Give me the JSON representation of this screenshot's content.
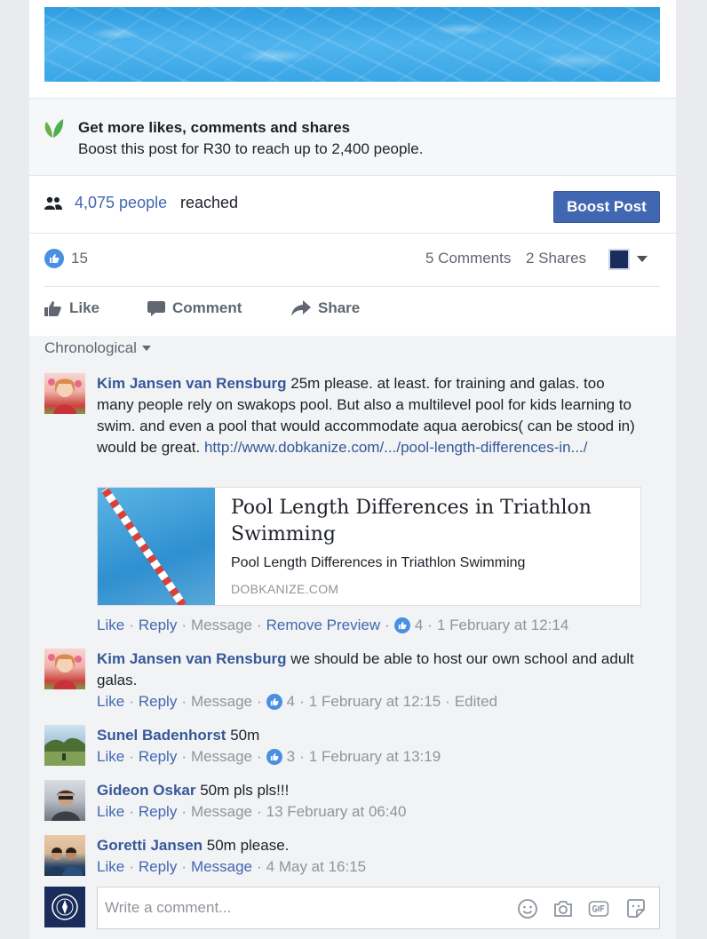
{
  "boost_cta": {
    "title": "Get more likes, comments and shares",
    "subtitle": "Boost this post for R30 to reach up to 2,400 people."
  },
  "reach": {
    "count": "4,075 people",
    "suffix": "reached",
    "boost_button": "Boost Post"
  },
  "stats": {
    "likes": "15",
    "comments": "5 Comments",
    "shares": "2 Shares"
  },
  "actions": {
    "like": "Like",
    "comment": "Comment",
    "share": "Share"
  },
  "comments_sort": "Chronological",
  "comments": [
    {
      "author": "Kim Jansen van Rensburg",
      "text": " 25m please. at least. for training and galas. too many people rely on swakops pool. But also a multilevel pool for kids learning to swim. and even a pool that would accommodate aqua aerobics( can be stood in) would be great. ",
      "link": "http://www.dobkanize.com/.../pool-length-differences-in.../",
      "preview": {
        "title": "Pool Length Differences in Triathlon Swimming",
        "subtitle": "Pool Length Differences in Triathlon Swimming",
        "domain": "DOBKANIZE.COM"
      },
      "meta": {
        "like": "Like",
        "reply": "Reply",
        "message": "Message",
        "remove_preview": "Remove Preview",
        "likes": "4",
        "time": "1 February at 12:14"
      }
    },
    {
      "author": "Kim Jansen van Rensburg",
      "text": " we should be able to host our own school and adult galas.",
      "meta": {
        "like": "Like",
        "reply": "Reply",
        "message": "Message",
        "likes": "4",
        "time": "1 February at 12:15",
        "edited": "Edited"
      }
    },
    {
      "author": "Sunel Badenhorst",
      "text": " 50m",
      "meta": {
        "like": "Like",
        "reply": "Reply",
        "message": "Message",
        "likes": "3",
        "time": "1 February at 13:19"
      }
    },
    {
      "author": "Gideon Oskar",
      "text": " 50m pls pls!!!",
      "meta": {
        "like": "Like",
        "reply": "Reply",
        "message": "Message",
        "time": "13 February at 06:40"
      }
    },
    {
      "author": "Goretti Jansen",
      "text": " 50m please.",
      "meta": {
        "like": "Like",
        "reply": "Reply",
        "message": "Message",
        "time": "4 May at 16:15"
      }
    }
  ],
  "compose": {
    "placeholder": "Write a comment..."
  },
  "colors": {
    "brand": "#4267b2",
    "link": "#365899",
    "muted": "#90949c",
    "like_badge": "#4a90e2"
  }
}
